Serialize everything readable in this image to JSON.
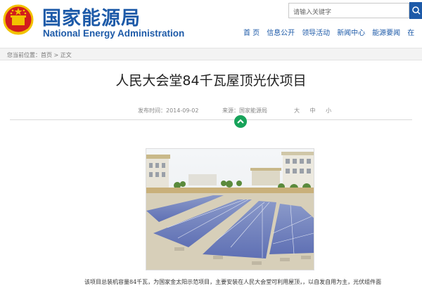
{
  "header": {
    "site_name_cn": "国家能源局",
    "site_name_en": "National Energy Administration",
    "search_placeholder": "请输入关键字",
    "nav": [
      "首 页",
      "信息公开",
      "领导活动",
      "新闻中心",
      "能源要闻",
      "在"
    ]
  },
  "breadcrumb": {
    "prefix": "您当前位置：",
    "items": [
      "首页",
      "正文"
    ],
    "separator": " > "
  },
  "article": {
    "title": "人民大会堂84千瓦屋顶光伏项目",
    "date": "发布时间：2014-09-02",
    "source": "来源：国家能源局",
    "font_sizes": "大 中 小",
    "body_first_line": "该项目总装机容量84千瓦，为国家金太阳示范项目，主要安装在人民大会堂可利用屋顶，，以自发自用为主，光伏组件面"
  },
  "icons": {
    "emblem": "national-emblem-icon",
    "search": "search-icon",
    "collapse": "chevron-up-icon"
  },
  "colors": {
    "brand_blue": "#1d5aa8",
    "accent_green": "#17a35a",
    "emblem_red": "#d21d1d",
    "emblem_gold": "#f2c200"
  }
}
